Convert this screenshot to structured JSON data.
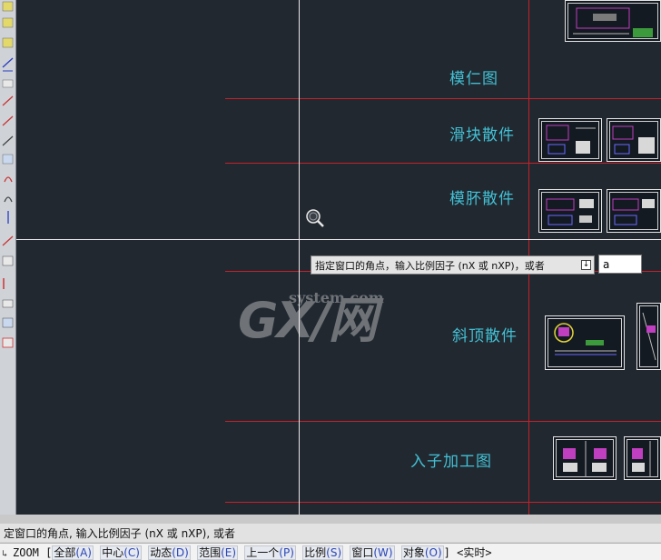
{
  "drawing": {
    "labels": {
      "mold_core": "模仁图",
      "slider_parts": "滑块散件",
      "mold_base_parts": "模肧散件",
      "lifter_parts": "斜顶散件",
      "insert_machining": "入子加工图"
    }
  },
  "tooltip": {
    "prompt": "指定窗口的角点，输入比例因子 (nX 或 nXP)，或者",
    "input_value": "a"
  },
  "watermark": {
    "logo": "GX/网",
    "site": "system.com"
  },
  "command": {
    "history": "定窗口的角点, 输入比例因子 (nX 或 nXP), 或者",
    "name": "ZOOM",
    "open_bracket": "[",
    "close_bracket": "]",
    "options": [
      {
        "label": "全部",
        "key": "(A)"
      },
      {
        "label": "中心",
        "key": "(C)"
      },
      {
        "label": "动态",
        "key": "(D)"
      },
      {
        "label": "范围",
        "key": "(E)"
      },
      {
        "label": "上一个",
        "key": "(P)"
      },
      {
        "label": "比例",
        "key": "(S)"
      },
      {
        "label": "窗口",
        "key": "(W)"
      },
      {
        "label": "对象",
        "key": "(O)"
      }
    ],
    "default": "<实时>"
  },
  "colors": {
    "canvas_bg": "#212830",
    "red_line": "#c7202a",
    "label_cyan": "#43c0d4",
    "crosshair": "#e8e8e8"
  }
}
